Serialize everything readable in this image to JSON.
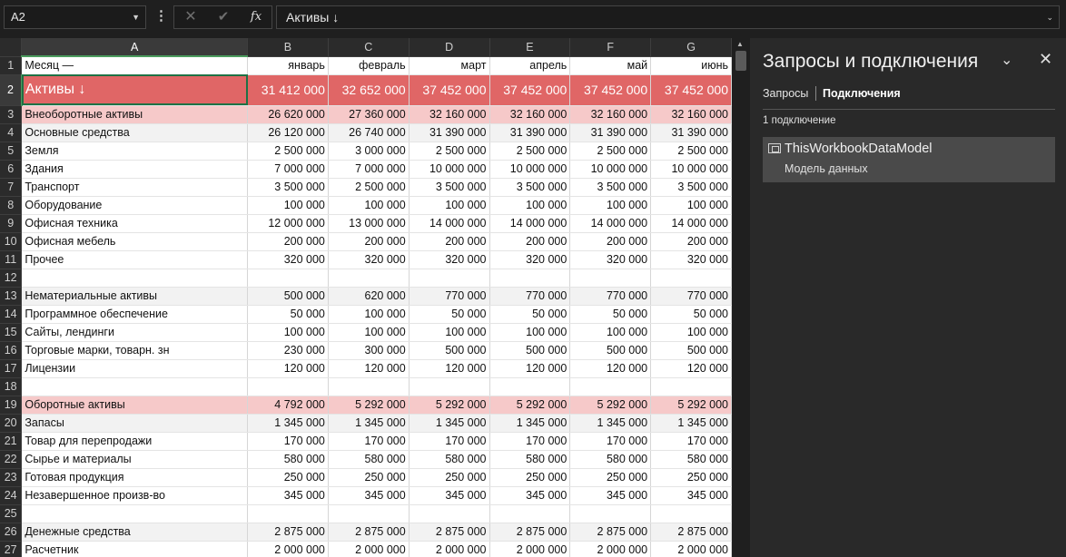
{
  "formula_bar": {
    "name_box": "A2",
    "name_box_dropdown": "▼",
    "more_icon": "⋮",
    "cancel_icon": "✕",
    "enter_icon": "✔",
    "fx_icon": "fx",
    "content": "Активы ↓",
    "expand_icon": "⌄"
  },
  "sheet": {
    "columns": [
      "A",
      "B",
      "C",
      "D",
      "E",
      "F",
      "G"
    ],
    "selected_column": "A",
    "rows": [
      {
        "n": "1",
        "style": "hdr1",
        "cells": [
          "Месяц —",
          "январь",
          "февраль",
          "март",
          "апрель",
          "май",
          "июнь"
        ]
      },
      {
        "n": "2",
        "style": "red",
        "cells": [
          "Активы ↓",
          "31 412 000",
          "32 652 000",
          "37 452 000",
          "37 452 000",
          "37 452 000",
          "37 452 000"
        ]
      },
      {
        "n": "3",
        "style": "pink",
        "cells": [
          "Внеоборотные активы",
          "26 620 000",
          "27 360 000",
          "32 160 000",
          "32 160 000",
          "32 160 000",
          "32 160 000"
        ]
      },
      {
        "n": "4",
        "style": "gray",
        "cells": [
          "Основные средства",
          "26 120 000",
          "26 740 000",
          "31 390 000",
          "31 390 000",
          "31 390 000",
          "31 390 000"
        ]
      },
      {
        "n": "5",
        "style": "white",
        "cells": [
          "Земля",
          "2 500 000",
          "3 000 000",
          "2 500 000",
          "2 500 000",
          "2 500 000",
          "2 500 000"
        ]
      },
      {
        "n": "6",
        "style": "white",
        "cells": [
          "Здания",
          "7 000 000",
          "7 000 000",
          "10 000 000",
          "10 000 000",
          "10 000 000",
          "10 000 000"
        ]
      },
      {
        "n": "7",
        "style": "white",
        "cells": [
          "Транспорт",
          "3 500 000",
          "2 500 000",
          "3 500 000",
          "3 500 000",
          "3 500 000",
          "3 500 000"
        ]
      },
      {
        "n": "8",
        "style": "white",
        "cells": [
          "Оборудование",
          "100 000",
          "100 000",
          "100 000",
          "100 000",
          "100 000",
          "100 000"
        ]
      },
      {
        "n": "9",
        "style": "white",
        "cells": [
          "Офисная техника",
          "12 000 000",
          "13 000 000",
          "14 000 000",
          "14 000 000",
          "14 000 000",
          "14 000 000"
        ]
      },
      {
        "n": "10",
        "style": "white",
        "cells": [
          "Офисная мебель",
          "200 000",
          "200 000",
          "200 000",
          "200 000",
          "200 000",
          "200 000"
        ]
      },
      {
        "n": "11",
        "style": "white",
        "cells": [
          "Прочее",
          "320 000",
          "320 000",
          "320 000",
          "320 000",
          "320 000",
          "320 000"
        ]
      },
      {
        "n": "12",
        "style": "white",
        "cells": [
          "",
          "",
          "",
          "",
          "",
          "",
          ""
        ]
      },
      {
        "n": "13",
        "style": "gray",
        "cells": [
          "Нематериальные активы",
          "500 000",
          "620 000",
          "770 000",
          "770 000",
          "770 000",
          "770 000"
        ]
      },
      {
        "n": "14",
        "style": "white",
        "cells": [
          "Программное обеспечение",
          "50 000",
          "100 000",
          "50 000",
          "50 000",
          "50 000",
          "50 000"
        ]
      },
      {
        "n": "15",
        "style": "white",
        "cells": [
          "Сайты, лендинги",
          "100 000",
          "100 000",
          "100 000",
          "100 000",
          "100 000",
          "100 000"
        ]
      },
      {
        "n": "16",
        "style": "white",
        "cells": [
          "Торговые марки, товарн. зн",
          "230 000",
          "300 000",
          "500 000",
          "500 000",
          "500 000",
          "500 000"
        ]
      },
      {
        "n": "17",
        "style": "white",
        "cells": [
          "Лицензии",
          "120 000",
          "120 000",
          "120 000",
          "120 000",
          "120 000",
          "120 000"
        ]
      },
      {
        "n": "18",
        "style": "white",
        "cells": [
          "",
          "",
          "",
          "",
          "",
          "",
          ""
        ]
      },
      {
        "n": "19",
        "style": "pink",
        "cells": [
          "Оборотные активы",
          "4 792 000",
          "5 292 000",
          "5 292 000",
          "5 292 000",
          "5 292 000",
          "5 292 000"
        ]
      },
      {
        "n": "20",
        "style": "gray",
        "cells": [
          "Запасы",
          "1 345 000",
          "1 345 000",
          "1 345 000",
          "1 345 000",
          "1 345 000",
          "1 345 000"
        ]
      },
      {
        "n": "21",
        "style": "white",
        "cells": [
          "Товар для перепродажи",
          "170 000",
          "170 000",
          "170 000",
          "170 000",
          "170 000",
          "170 000"
        ]
      },
      {
        "n": "22",
        "style": "white",
        "cells": [
          "Сырье и материалы",
          "580 000",
          "580 000",
          "580 000",
          "580 000",
          "580 000",
          "580 000"
        ]
      },
      {
        "n": "23",
        "style": "white",
        "cells": [
          "Готовая продукция",
          "250 000",
          "250 000",
          "250 000",
          "250 000",
          "250 000",
          "250 000"
        ]
      },
      {
        "n": "24",
        "style": "white",
        "cells": [
          "Незавершенное произв-во",
          "345 000",
          "345 000",
          "345 000",
          "345 000",
          "345 000",
          "345 000"
        ]
      },
      {
        "n": "25",
        "style": "white",
        "cells": [
          "",
          "",
          "",
          "",
          "",
          "",
          ""
        ]
      },
      {
        "n": "26",
        "style": "gray",
        "cells": [
          "Денежные средства",
          "2 875 000",
          "2 875 000",
          "2 875 000",
          "2 875 000",
          "2 875 000",
          "2 875 000"
        ]
      },
      {
        "n": "27",
        "style": "white",
        "cells": [
          "Расчетник",
          "2 000 000",
          "2 000 000",
          "2 000 000",
          "2 000 000",
          "2 000 000",
          "2 000 000"
        ]
      }
    ]
  },
  "pane": {
    "title": "Запросы и подключения",
    "collapse_icon": "⌄",
    "close_icon": "✕",
    "tabs": [
      "Запросы",
      "Подключения"
    ],
    "active_tab": "Подключения",
    "count": "1 подключение",
    "connection": {
      "name": "ThisWorkbookDataModel",
      "description": "Модель данных"
    }
  },
  "colors": {
    "highlight_red": "#e06666",
    "highlight_pink": "#f6c9c9",
    "selection_green": "#1e7145"
  }
}
